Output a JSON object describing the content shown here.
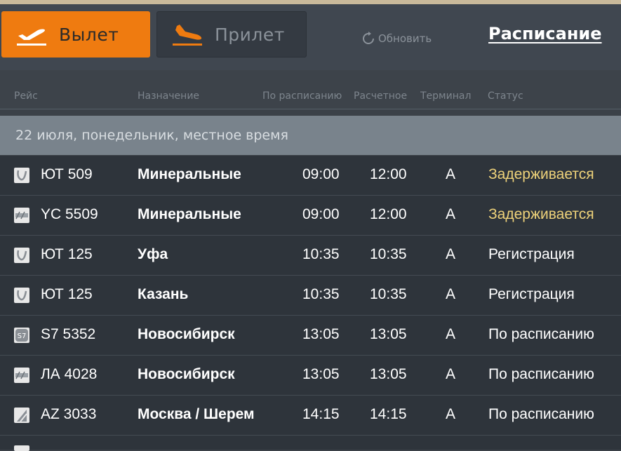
{
  "tabs": {
    "departure": {
      "label": "Вылет",
      "icon": "plane-takeoff-icon"
    },
    "arrival": {
      "label": "Прилет",
      "icon": "plane-landing-icon"
    }
  },
  "refresh": {
    "label": "Обновить",
    "icon": "refresh-icon"
  },
  "schedule_link": "Расписание",
  "columns": {
    "flight": "Рейс",
    "destination": "Назначение",
    "scheduled": "По расписанию",
    "estimated": "Расчетное",
    "terminal": "Терминал",
    "status": "Статус"
  },
  "date_band": "22 июля, понедельник, местное время",
  "colors": {
    "accent": "#ef7b10",
    "delayed": "#eed27a"
  },
  "flights": [
    {
      "airline_icon": "utair-logo-icon",
      "flight": "ЮТ 509",
      "destination": "Минеральные",
      "scheduled": "09:00",
      "estimated": "12:00",
      "terminal": "A",
      "status": "Задерживается",
      "delayed": true
    },
    {
      "airline_icon": "airline-logo-icon",
      "flight": "YC 5509",
      "destination": "Минеральные",
      "scheduled": "09:00",
      "estimated": "12:00",
      "terminal": "A",
      "status": "Задерживается",
      "delayed": true
    },
    {
      "airline_icon": "utair-logo-icon",
      "flight": "ЮТ 125",
      "destination": "Уфа",
      "scheduled": "10:35",
      "estimated": "10:35",
      "terminal": "A",
      "status": "Регистрация",
      "delayed": false
    },
    {
      "airline_icon": "utair-logo-icon",
      "flight": "ЮТ 125",
      "destination": "Казань",
      "scheduled": "10:35",
      "estimated": "10:35",
      "terminal": "A",
      "status": "Регистрация",
      "delayed": false
    },
    {
      "airline_icon": "s7-logo-icon",
      "flight": "S7 5352",
      "destination": "Новосибирск",
      "scheduled": "13:05",
      "estimated": "13:05",
      "terminal": "A",
      "status": "По расписанию",
      "delayed": false
    },
    {
      "airline_icon": "airline-logo-icon",
      "flight": "ЛА 4028",
      "destination": "Новосибирск",
      "scheduled": "13:05",
      "estimated": "13:05",
      "terminal": "A",
      "status": "По расписанию",
      "delayed": false
    },
    {
      "airline_icon": "alitalia-logo-icon",
      "flight": "AZ 3033",
      "destination": "Москва / Шерем",
      "scheduled": "14:15",
      "estimated": "14:15",
      "terminal": "A",
      "status": "По расписанию",
      "delayed": false
    }
  ]
}
